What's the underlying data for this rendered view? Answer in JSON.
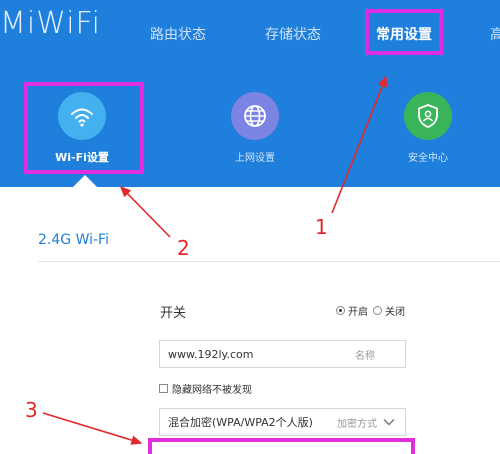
{
  "logo": "MiWiFi",
  "nav": {
    "tabs": [
      {
        "label": "路由状态"
      },
      {
        "label": "存储状态"
      },
      {
        "label": "常用设置",
        "active": true
      },
      {
        "label": "高"
      }
    ]
  },
  "menu": {
    "items": [
      {
        "label": "Wi-Fi设置",
        "icon": "wifi-icon",
        "color": "#43b0f0",
        "active": true
      },
      {
        "label": "上网设置",
        "icon": "globe-icon",
        "color": "#7b83e3"
      },
      {
        "label": "安全中心",
        "icon": "shield-icon",
        "color": "#3bb55a"
      }
    ]
  },
  "section": {
    "title": "2.4G Wi-Fi"
  },
  "form": {
    "switch": {
      "label": "开关",
      "on": "开启",
      "off": "关闭",
      "value": "on"
    },
    "ssid": {
      "value": "www.192ly.com",
      "suffix": "名称"
    },
    "hidden": {
      "label": "隐藏网络不被发现",
      "checked": false
    },
    "encryption": {
      "value": "混合加密(WPA/WPA2个人版)",
      "suffix": "加密方式"
    }
  },
  "annotations": [
    "1",
    "2",
    "3"
  ],
  "colors": {
    "header": "#1e7fdc",
    "highlight": "#e02de0",
    "arrow": "#e2282c",
    "link": "#1f7fd9"
  }
}
